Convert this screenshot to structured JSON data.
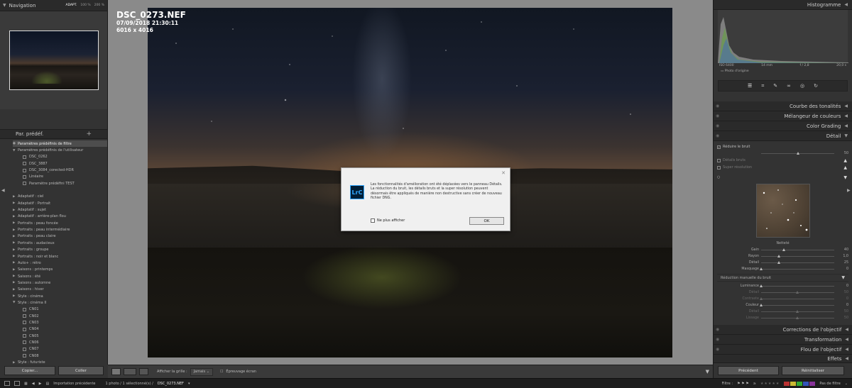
{
  "navigator": {
    "title": "Navigation",
    "zoom_options": [
      "ADAPT.",
      "100 %",
      "200 %"
    ]
  },
  "presets": {
    "title": "Par. prédéf.",
    "items": [
      {
        "label": "Paramètres prédéfinis de filtre",
        "level": 0,
        "type": "filter",
        "selected": true
      },
      {
        "label": "Paramètres prédéfinis de l'utilisateur",
        "level": 0,
        "type": "folder-open"
      },
      {
        "label": "DSC_0262",
        "level": 2,
        "type": "item"
      },
      {
        "label": "DSC_3887",
        "level": 2,
        "type": "item"
      },
      {
        "label": "DSC_3084_corected-HDR",
        "level": 2,
        "type": "item"
      },
      {
        "label": "Linéaire",
        "level": 2,
        "type": "item"
      },
      {
        "label": "Paramètre prédéfini TEST",
        "level": 2,
        "type": "item"
      },
      {
        "label": "",
        "level": 0,
        "type": "spacer"
      },
      {
        "label": "Adaptatif : ciel",
        "level": 0,
        "type": "folder"
      },
      {
        "label": "Adaptatif : Portrait",
        "level": 0,
        "type": "folder"
      },
      {
        "label": "Adaptatif : sujet",
        "level": 0,
        "type": "folder"
      },
      {
        "label": "Adaptatif : arrière-plan flou",
        "level": 0,
        "type": "folder"
      },
      {
        "label": "Portraits : peau foncée",
        "level": 0,
        "type": "folder"
      },
      {
        "label": "Portraits : peau intermédiaire",
        "level": 0,
        "type": "folder"
      },
      {
        "label": "Portraits : peau claire",
        "level": 0,
        "type": "folder"
      },
      {
        "label": "Portraits : audacieux",
        "level": 0,
        "type": "folder"
      },
      {
        "label": "Portraits : groupe",
        "level": 0,
        "type": "folder"
      },
      {
        "label": "Portraits : noir et blanc",
        "level": 0,
        "type": "folder"
      },
      {
        "label": "Auto+ : rétro",
        "level": 0,
        "type": "folder"
      },
      {
        "label": "Saisons : printemps",
        "level": 0,
        "type": "folder"
      },
      {
        "label": "Saisons : été",
        "level": 0,
        "type": "folder"
      },
      {
        "label": "Saisons : automne",
        "level": 0,
        "type": "folder"
      },
      {
        "label": "Saisons : hiver",
        "level": 0,
        "type": "folder"
      },
      {
        "label": "Style : cinéma",
        "level": 0,
        "type": "folder"
      },
      {
        "label": "Style : cinéma II",
        "level": 0,
        "type": "folder-open"
      },
      {
        "label": "CN01",
        "level": 2,
        "type": "item"
      },
      {
        "label": "CN02",
        "level": 2,
        "type": "item"
      },
      {
        "label": "CN03",
        "level": 2,
        "type": "item"
      },
      {
        "label": "CN04",
        "level": 2,
        "type": "item"
      },
      {
        "label": "CN05",
        "level": 2,
        "type": "item"
      },
      {
        "label": "CN06",
        "level": 2,
        "type": "item"
      },
      {
        "label": "CN07",
        "level": 2,
        "type": "item"
      },
      {
        "label": "CN08",
        "level": 2,
        "type": "item"
      },
      {
        "label": "Style : futuriste",
        "level": 0,
        "type": "folder"
      }
    ]
  },
  "left_buttons": {
    "copy": "Copier...",
    "paste": "Coller"
  },
  "photo": {
    "filename": "DSC_0273.NEF",
    "datetime": "07/09/2018 21:30:11",
    "dimensions": "6016 x 4016"
  },
  "dialog": {
    "logo": "LrC",
    "message": "Les fonctionnalités d'amélioration ont été déplacées vers le panneau Détails. La réduction du bruit, les détails bruts et la super résolution peuvent désormais être appliqués de manière non destructive sans créer de nouveau fichier DNG.",
    "checkbox_label": "Ne plus afficher",
    "ok_label": "OK"
  },
  "toolbar": {
    "grid_label": "Afficher la grille :",
    "grid_value": "Jamais",
    "softproof_label": "Épreuvage écran"
  },
  "histogram": {
    "title": "Histogramme",
    "iso": "ISO 6400",
    "focal": "14 mm",
    "aperture": "f / 2,8",
    "shutter": "20,0 s",
    "original_label": "Photo d'origine"
  },
  "right_sections": {
    "tone_curve": "Courbe des tonalités",
    "color_mixer": "Mélangeur de couleurs",
    "color_grading": "Color Grading",
    "detail": "Détail",
    "lens_corrections": "Corrections de l'objectif",
    "transform": "Transformation",
    "lens_blur": "Flou de l'objectif",
    "effects": "Effets"
  },
  "detail": {
    "denoise_label": "Réduire le bruit",
    "denoise_value": "50",
    "raw_details_label": "Détails bruts",
    "super_res_label": "Super résolution",
    "sharpening_title": "Netteté",
    "sharpening": [
      {
        "label": "Gain",
        "value": "40",
        "pos": 0.32
      },
      {
        "label": "Rayon",
        "value": "1,0",
        "pos": 0.25
      },
      {
        "label": "Détail",
        "value": "25",
        "pos": 0.25
      },
      {
        "label": "Masquage",
        "value": "0",
        "pos": 0.0
      }
    ],
    "manual_nr_title": "Réduction manuelle du bruit",
    "manual_nr": [
      {
        "label": "Luminance",
        "value": "0",
        "pos": 0.0,
        "dim": false
      },
      {
        "label": "Détail",
        "value": "50",
        "pos": 0.5,
        "dim": true
      },
      {
        "label": "Contraste",
        "value": "0",
        "pos": 0.0,
        "dim": true
      },
      {
        "label": "Couleur",
        "value": "0",
        "pos": 0.0,
        "dim": false
      },
      {
        "label": "Détail",
        "value": "50",
        "pos": 0.5,
        "dim": true
      },
      {
        "label": "Lissage",
        "value": "50",
        "pos": 0.5,
        "dim": true
      }
    ]
  },
  "right_buttons": {
    "previous": "Précédent",
    "reset": "Réinitialiser"
  },
  "statusbar": {
    "import_label": "Importation précédente",
    "photo_count": "1 photo / 1 sélectionné(s) /",
    "current_file": "DSC_0273.NEF",
    "filter_label": "Filtre :",
    "filter_state": "Pas de filtre",
    "colors": [
      "#b33",
      "#cb3",
      "#3a3",
      "#35b",
      "#839"
    ]
  }
}
